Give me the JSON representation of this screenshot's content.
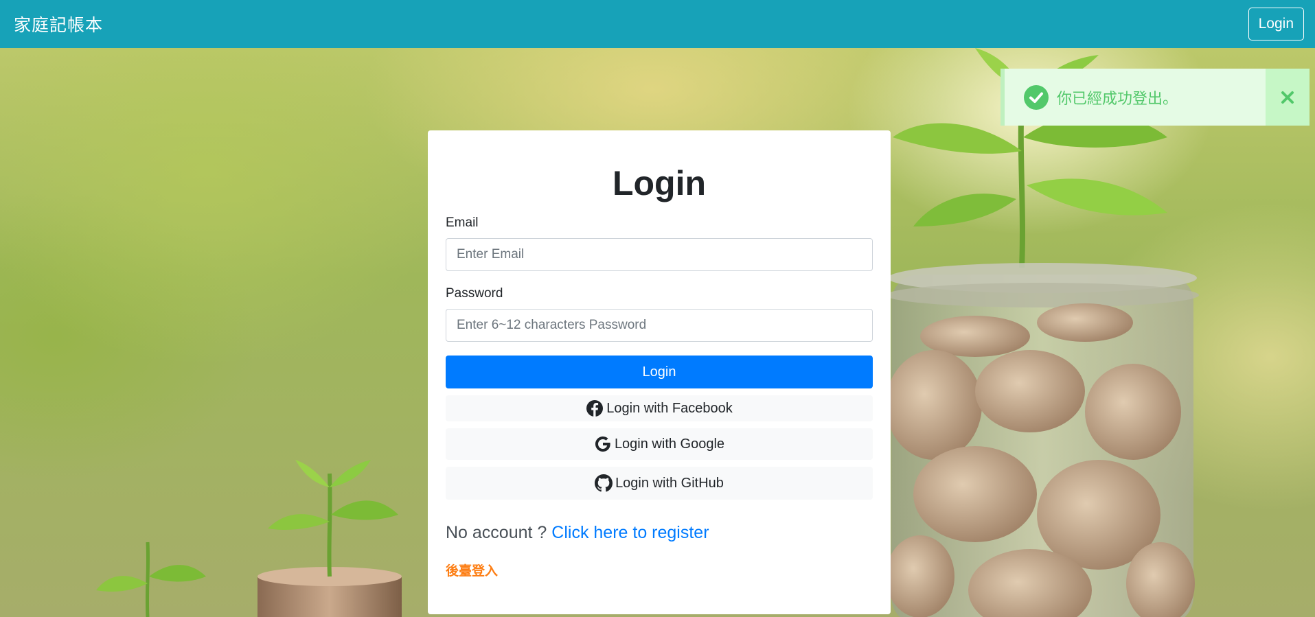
{
  "navbar": {
    "brand": "家庭記帳本",
    "login_label": "Login"
  },
  "toast": {
    "message": "你已經成功登出。",
    "icon": "check-circle-icon",
    "close_icon": "close-icon",
    "text_color": "#52c86a",
    "background": "#e5fbe5"
  },
  "login_card": {
    "title": "Login",
    "email_label": "Email",
    "email_placeholder": "Enter Email",
    "email_value": "",
    "password_label": "Password",
    "password_placeholder": "Enter 6~12 characters Password",
    "password_value": "",
    "submit_label": "Login",
    "facebook_label": "Login with Facebook",
    "google_label": "Login with Google",
    "github_label": "Login with GitHub",
    "no_account_text": "No account ?",
    "register_link": "Click here to register",
    "admin_login": "後臺登入"
  },
  "colors": {
    "navbar": "#17a2b8",
    "primary": "#007bff",
    "admin_link": "#fd7e14",
    "social_button_bg": "#f8f9fa"
  }
}
